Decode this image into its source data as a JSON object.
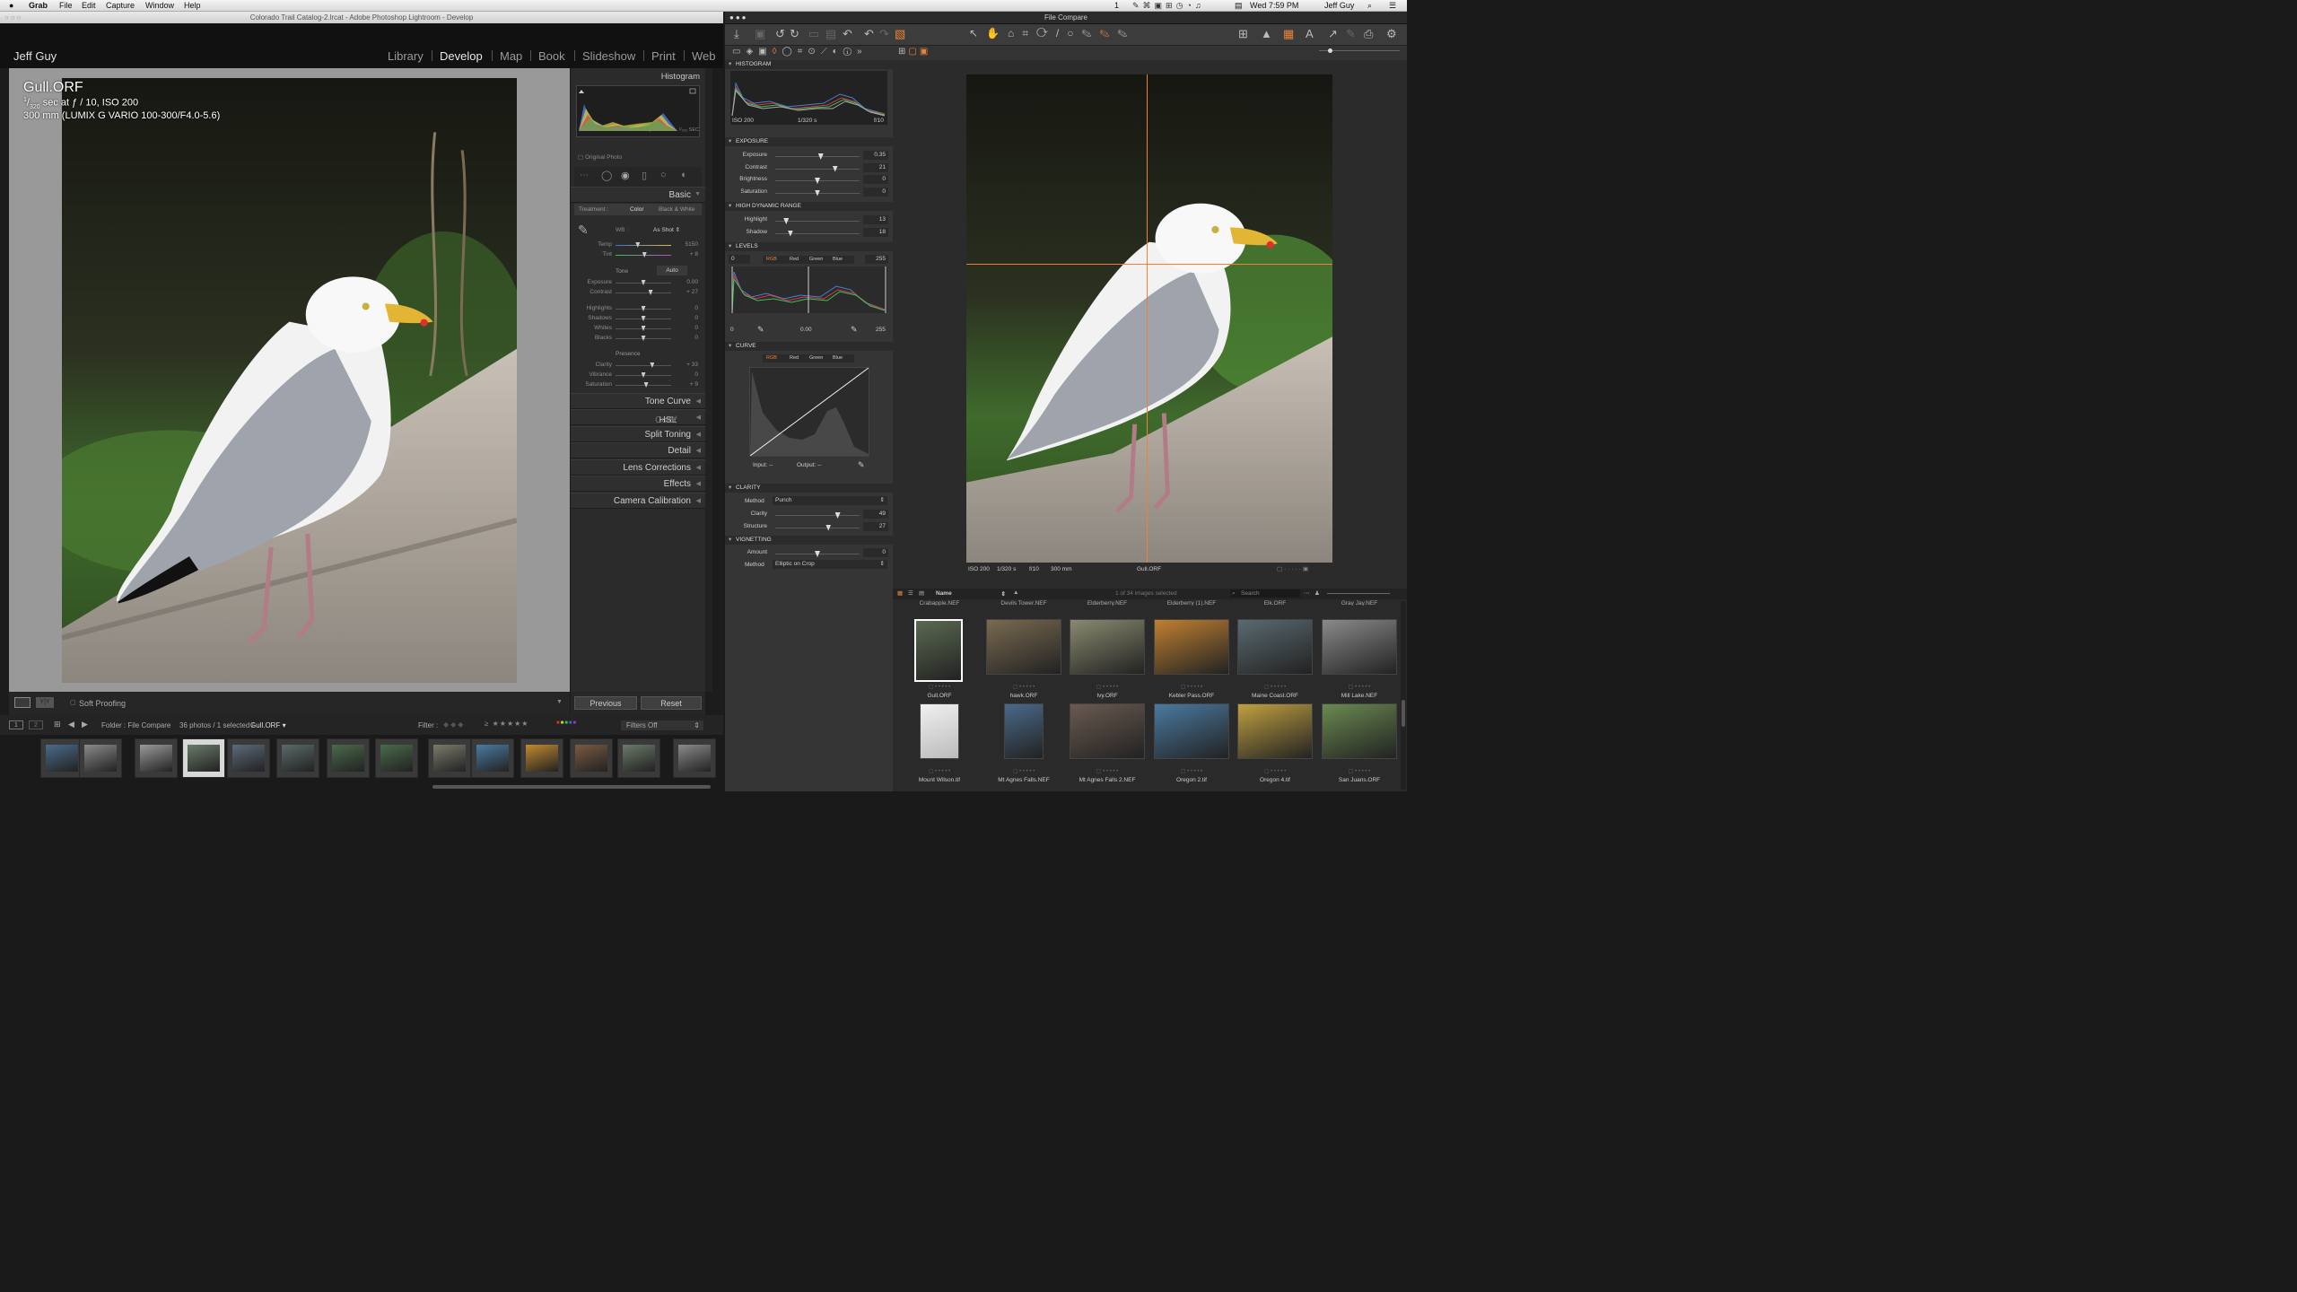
{
  "menubar": {
    "app": "Grab",
    "menus": [
      "File",
      "Edit",
      "Capture",
      "Window",
      "Help"
    ],
    "right": {
      "input": "1",
      "datetime": "Wed 7:59 PM",
      "user": "Jeff Guy"
    }
  },
  "lightroom": {
    "window_title": "Colorado Trail Catalog-2.lrcat - Adobe Photoshop Lightroom - Develop",
    "identity": "Jeff Guy",
    "modules": [
      "Library",
      "Develop",
      "Map",
      "Book",
      "Slideshow",
      "Print",
      "Web"
    ],
    "active_module": "Develop",
    "photo": {
      "filename": "Gull.ORF",
      "shutter_num": "1",
      "shutter_den": "320",
      "exposure_rest": "sec at ƒ / 10, ISO 200",
      "lens": "300 mm (LUMIX G VARIO 100-300/F4.0-5.6)"
    },
    "histogram": {
      "title": "Histogram",
      "info": [
        "ISO 200",
        "300 mm",
        "ƒ / 10",
        "¹⁄₃₂₀ SEC"
      ],
      "original_photo": "Original Photo"
    },
    "basic": {
      "title": "Basic",
      "treatment_label": "Treatment :",
      "treatment_color": "Color",
      "treatment_bw": "Black & White",
      "wb_label": "WB :",
      "wb_value": "As Shot",
      "temp": {
        "label": "Temp",
        "value": "5150",
        "pos": 0.4
      },
      "tint": {
        "label": "Tint",
        "value": "+ 8",
        "pos": 0.52
      },
      "tone_label": "Tone",
      "auto_label": "Auto",
      "tone_sliders": [
        {
          "label": "Exposure",
          "value": "0.00",
          "pos": 0.5
        },
        {
          "label": "Contrast",
          "value": "+ 27",
          "pos": 0.63
        }
      ],
      "tone_sliders2": [
        {
          "label": "Highlights",
          "value": "0",
          "pos": 0.5
        },
        {
          "label": "Shadows",
          "value": "0",
          "pos": 0.5
        },
        {
          "label": "Whites",
          "value": "0",
          "pos": 0.5
        },
        {
          "label": "Blacks",
          "value": "0",
          "pos": 0.5
        }
      ],
      "presence_label": "Presence",
      "presence_sliders": [
        {
          "label": "Clarity",
          "value": "+ 33",
          "pos": 0.66
        },
        {
          "label": "Vibrance",
          "value": "0",
          "pos": 0.5
        },
        {
          "label": "Saturation",
          "value": "+ 9",
          "pos": 0.55
        }
      ]
    },
    "panels": [
      "Tone Curve",
      "HSL / Color / B&W",
      "Split Toning",
      "Detail",
      "Lens Corrections",
      "Effects",
      "Camera Calibration"
    ],
    "hsl_parts": [
      "HSL",
      "/",
      "Color",
      "/",
      "B & W"
    ],
    "toolbar": {
      "soft_proofing": "Soft Proofing",
      "previous": "Previous",
      "reset": "Reset"
    },
    "filmstrip_bar": {
      "pages": [
        "1",
        "2"
      ],
      "folder": "Folder : File Compare",
      "count": "36 photos / 1 selected /",
      "selected": "Gull.ORF",
      "filter_label": "Filter :",
      "filters_off": "Filters Off"
    }
  },
  "captureone": {
    "window_title": "File Compare",
    "histogram": {
      "title": "HISTOGRAM",
      "iso": "ISO 200",
      "shutter": "1/320 s",
      "aperture": "f/10"
    },
    "exposure": {
      "title": "EXPOSURE",
      "sliders": [
        {
          "label": "Exposure",
          "value": "0.35",
          "pos": 0.54
        },
        {
          "label": "Contrast",
          "value": "21",
          "pos": 0.71
        },
        {
          "label": "Brightness",
          "value": "0",
          "pos": 0.5
        },
        {
          "label": "Saturation",
          "value": "0",
          "pos": 0.5
        }
      ]
    },
    "hdr": {
      "title": "HIGH DYNAMIC RANGE",
      "sliders": [
        {
          "label": "Highlight",
          "value": "13",
          "pos": 0.13
        },
        {
          "label": "Shadow",
          "value": "18",
          "pos": 0.18
        }
      ]
    },
    "levels": {
      "title": "LEVELS",
      "tabs": [
        "RGB",
        "Red",
        "Green",
        "Blue"
      ],
      "low": "0",
      "high": "255",
      "out_low": "0",
      "mid": "0.00",
      "out_high": "255"
    },
    "curve": {
      "title": "CURVE",
      "tabs": [
        "RGB",
        "Red",
        "Green",
        "Blue"
      ],
      "input_label": "Input:",
      "input_value": "--",
      "output_label": "Output:",
      "output_value": "--"
    },
    "clarity": {
      "title": "CLARITY",
      "method_label": "Method",
      "method_value": "Punch",
      "sliders": [
        {
          "label": "Clarity",
          "value": "49",
          "pos": 0.74
        },
        {
          "label": "Structure",
          "value": "27",
          "pos": 0.63
        }
      ]
    },
    "vignetting": {
      "title": "VIGNETTING",
      "amount_label": "Amount",
      "amount_value": "0",
      "amount_pos": 0.5,
      "method_label": "Method",
      "method_value": "Elliptic on Crop"
    },
    "viewer_info": {
      "iso": "ISO 200",
      "shutter": "1/320 s",
      "aperture": "f/10",
      "focal": "300 mm",
      "filename": "Gull.ORF"
    },
    "browser": {
      "sort": "Name",
      "count": "1 of 34 images selected",
      "search_placeholder": "Search",
      "top_cut": [
        "Crabapple.NEF",
        "Devils Tower.NEF",
        "Elderberry.NEF",
        "Elderberry (1).NEF",
        "Elk.ORF",
        "Gray Jay.NEF"
      ],
      "row1": [
        "Gull.ORF",
        "hawk.ORF",
        "Ivy.ORF",
        "Kebler Pass.ORF",
        "Maine Coast.ORF",
        "Mill Lake.NEF"
      ],
      "row2": [
        "Mount Wilson.tif",
        "Mt Agnes Falls.NEF",
        "Mt Agnes Falls 2.NEF",
        "Oregon 2.tif",
        "Oregon 4.tif",
        "San Juans.ORF"
      ]
    }
  },
  "colors": {
    "lr_bg": "#1c1c1c",
    "co_bg": "#303030",
    "co_accent": "#e8833a",
    "lr_active": "#e8e8e8"
  }
}
